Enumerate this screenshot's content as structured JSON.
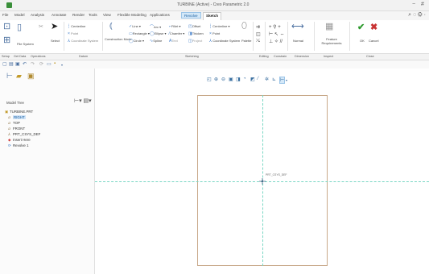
{
  "titlebar": {
    "title": "TURBINE (Active) - Creo Parametric 2.0",
    "controls": [
      "−",
      "#"
    ]
  },
  "menubar": {
    "tabs": [
      "File",
      "Model",
      "Analysis",
      "Annotate",
      "Render",
      "Tools",
      "View",
      "Flexible Modeling",
      "Applications",
      "Revolve",
      "Sketch"
    ],
    "active_app_tab": "Revolve",
    "active_tab": "Sketch"
  },
  "ribbon": {
    "file_system": "File System",
    "select": "Select",
    "centerline": "Centerline",
    "point": "Point",
    "coordinate_system": "Coordinate System",
    "construction_mode": "Construction Mode",
    "line": "Line",
    "arc": "Arc",
    "fillet": "Fillet",
    "offset": "Offset",
    "rectangle": "Rectangle",
    "ellipse": "Ellipse",
    "chamfer": "Chamfer",
    "thicken": "Thicken",
    "circle": "Circle",
    "spline": "Spline",
    "text": "Text",
    "project": "Project",
    "centerline2": "Centerline",
    "point2": "Point",
    "coordinate_system2": "Coordinate System",
    "palette": "Palette",
    "normal": "Normal",
    "feature_requirements": "Feature Requirements",
    "ok": "OK",
    "cancel": "Cancel"
  },
  "groups": [
    "Setup",
    "Get Data",
    "Operations",
    "Datum",
    "Sketching",
    "Editing",
    "Constrain",
    "Dimension",
    "Inspect",
    "Close"
  ],
  "model_tree": {
    "header": "Model Tree",
    "items": [
      {
        "label": "TURBINE.PRT",
        "kind": "root"
      },
      {
        "label": "RIGHT",
        "kind": "datum",
        "highlight": true
      },
      {
        "label": "TOP",
        "kind": "datum"
      },
      {
        "label": "FRONT",
        "kind": "datum"
      },
      {
        "label": "PRT_CSYS_DEF",
        "kind": "csys"
      },
      {
        "label": "Insert Here",
        "kind": "insert"
      },
      {
        "label": "Revolve 1",
        "kind": "rev"
      }
    ]
  },
  "graphics": {
    "csys_label": "PRT_CSYS_DEF"
  },
  "colors": {
    "sketch_frame": "#c8a98a",
    "axis": "#7ad7c4",
    "highlight": "#cfe3f7",
    "accent": "#3a7ac8"
  }
}
